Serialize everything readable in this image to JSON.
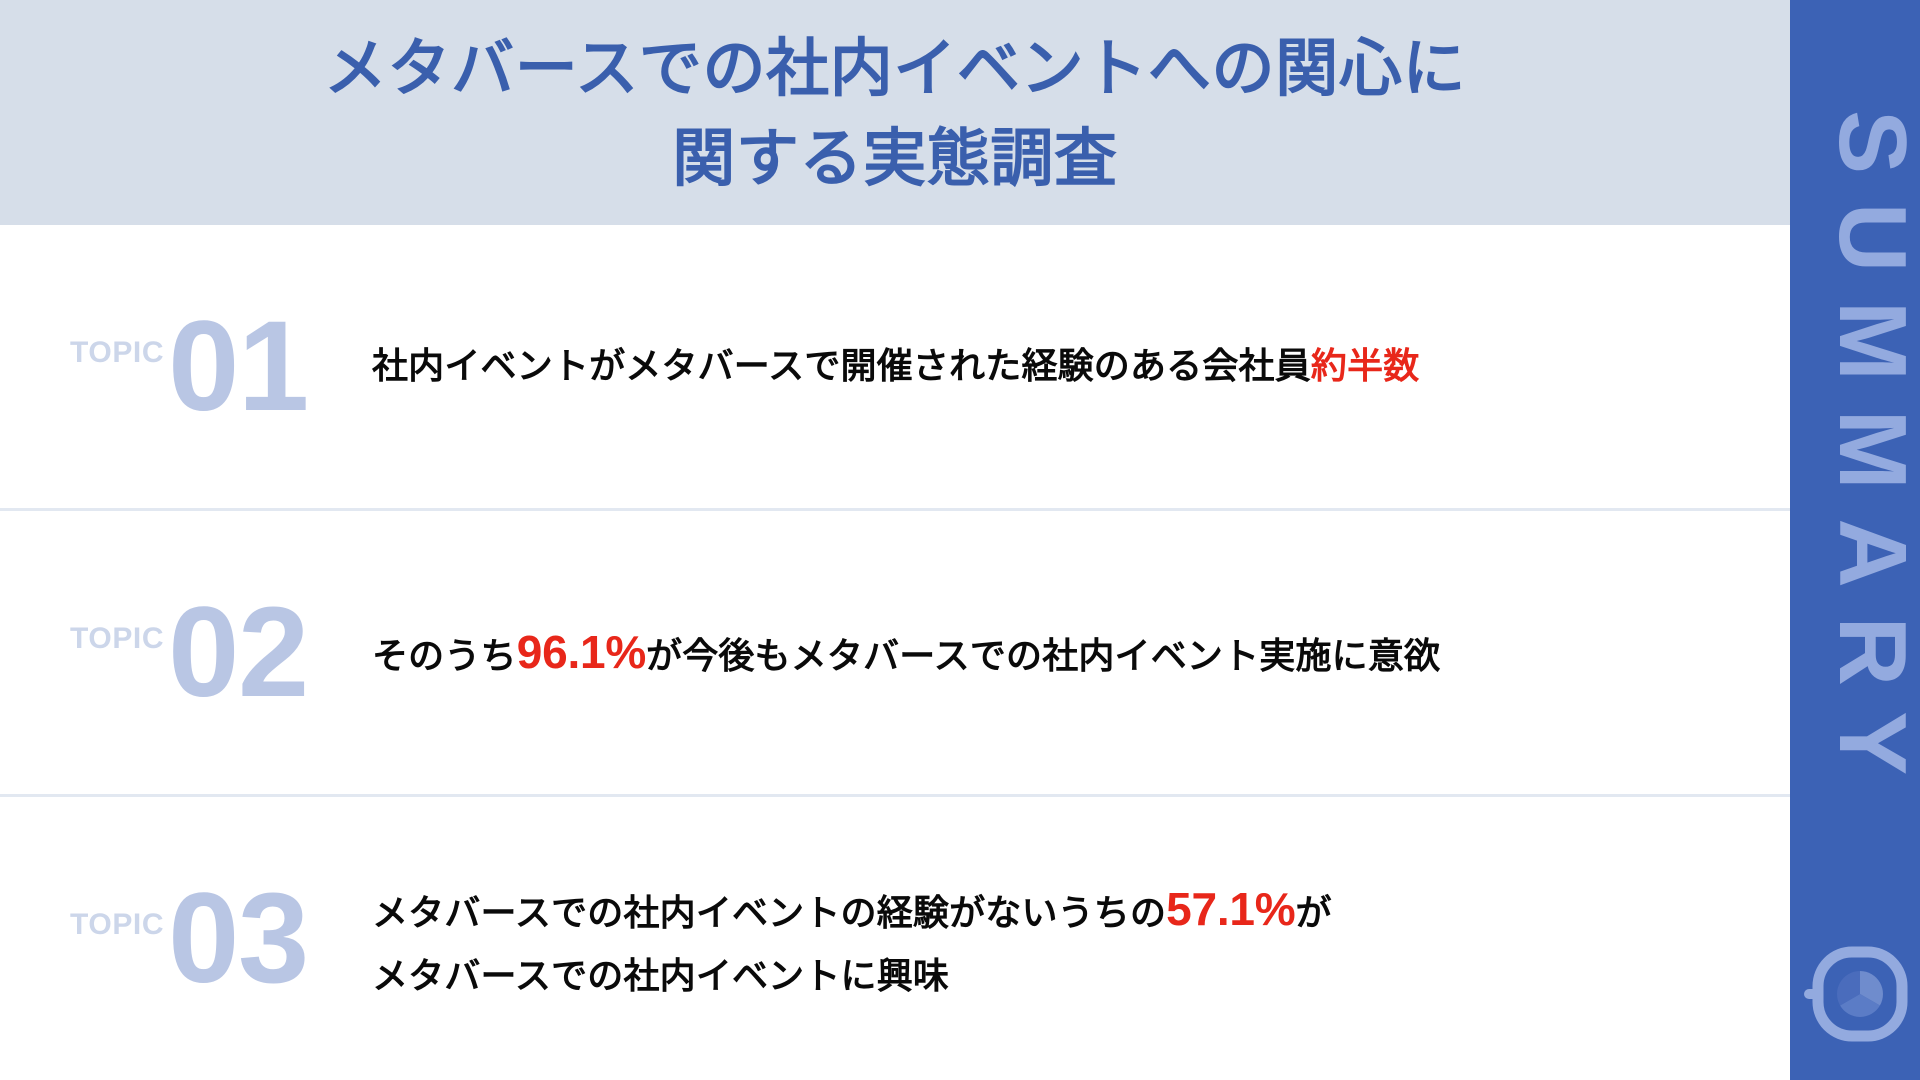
{
  "header": {
    "title_line1": "メタバースでの社内イベントへの関心に",
    "title_line2": "関する実態調査",
    "background_color": "#D6DEE9",
    "title_color": "#3A5FAD"
  },
  "sidebar": {
    "label": "SUMMARY",
    "background_color": "#3C62B5",
    "text_color": "#93AADF",
    "logo_icon": "circle-pie-logo-icon"
  },
  "topics": [
    {
      "eyebrow": "TOPIC",
      "number": "01",
      "lines": [
        {
          "segments": [
            {
              "text": "社内イベントがメタバースで開催された経験のある会社員",
              "style": "plain"
            },
            {
              "text": "約半数",
              "style": "highlight"
            }
          ]
        }
      ],
      "plain_text": "社内イベントがメタバースで開催された経験のある会社員約半数",
      "highlight_value": "約半数"
    },
    {
      "eyebrow": "TOPIC",
      "number": "02",
      "lines": [
        {
          "segments": [
            {
              "text": "そのうち",
              "style": "plain"
            },
            {
              "text": "96.1%",
              "style": "percent"
            },
            {
              "text": "が今後もメタバースでの社内イベント実施に意欲",
              "style": "plain"
            }
          ]
        }
      ],
      "plain_text": "そのうち96.1%が今後もメタバースでの社内イベント実施に意欲",
      "highlight_value": "96.1%"
    },
    {
      "eyebrow": "TOPIC",
      "number": "03",
      "lines": [
        {
          "segments": [
            {
              "text": "メタバースでの社内イベントの経験がないうちの",
              "style": "plain"
            },
            {
              "text": "57.1%",
              "style": "percent"
            },
            {
              "text": "が",
              "style": "plain"
            }
          ]
        },
        {
          "segments": [
            {
              "text": "メタバースでの社内イベントに興味",
              "style": "plain"
            }
          ]
        }
      ],
      "plain_text": "メタバースでの社内イベントの経験がないうちの57.1%がメタバースでの社内イベントに興味",
      "highlight_value": "57.1%"
    }
  ],
  "colors": {
    "accent_red": "#E8271A",
    "topic_number": "#B9C6E4",
    "topic_word": "#CCD6EA",
    "divider": "#E2E8F1",
    "body_text": "#0A0A0A"
  }
}
